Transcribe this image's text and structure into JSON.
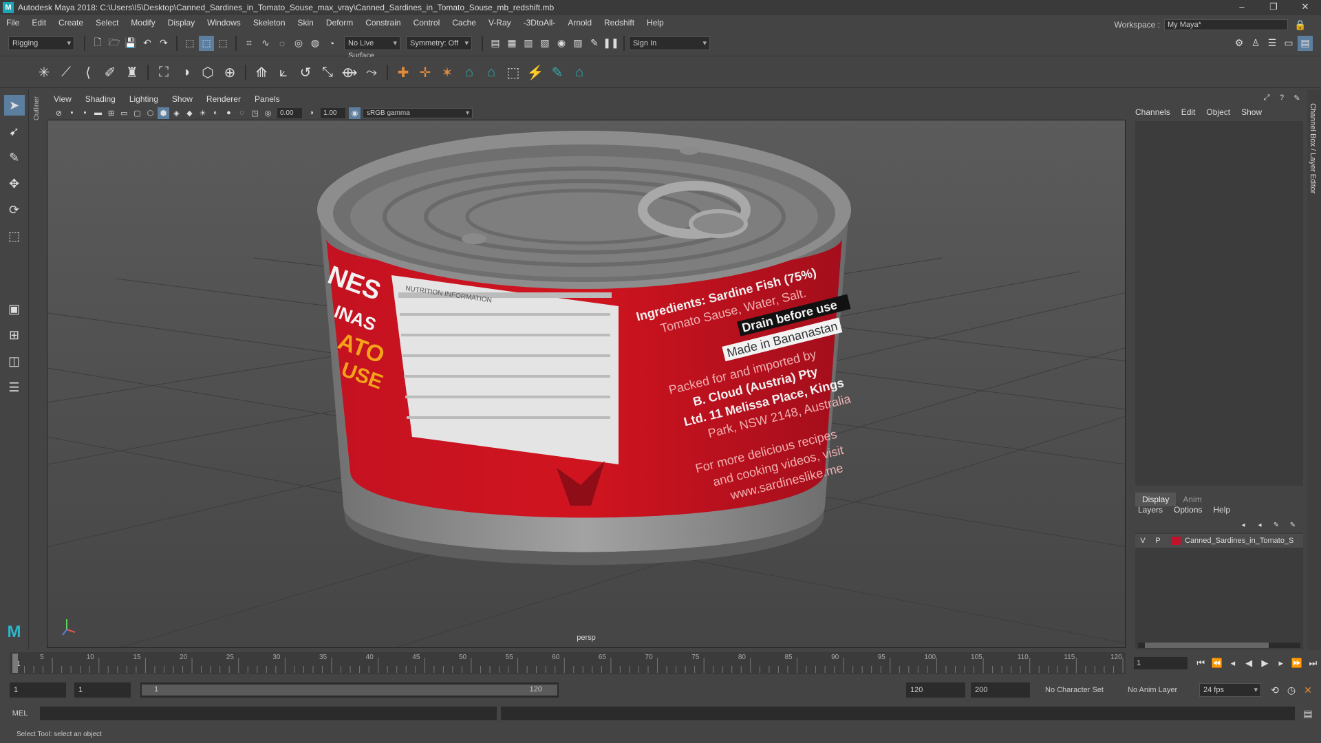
{
  "window": {
    "title": "Autodesk Maya 2018: C:\\Users\\I5\\Desktop\\Canned_Sardines_in_Tomato_Souse_max_vray\\Canned_Sardines_in_Tomato_Souse_mb_redshift.mb",
    "app_icon": "maya-logo-icon",
    "minimize": "–",
    "restore": "❐",
    "close": "✕"
  },
  "menubar": {
    "items": [
      "File",
      "Edit",
      "Create",
      "Select",
      "Modify",
      "Display",
      "Windows",
      "Skeleton",
      "Skin",
      "Deform",
      "Constrain",
      "Control",
      "Cache",
      "V-Ray",
      "-3DtoAll-",
      "Arnold",
      "Redshift",
      "Help"
    ],
    "workspace_label": "Workspace :",
    "workspace_value": "My Maya*"
  },
  "statusline": {
    "menuset": "Rigging",
    "live_surface": "No Live Surface",
    "symmetry": "Symmetry: Off",
    "sign_in": "Sign In"
  },
  "viewport": {
    "menu": [
      "View",
      "Shading",
      "Lighting",
      "Show",
      "Renderer",
      "Panels"
    ],
    "exposure": "0.00",
    "gamma": "1.00",
    "color_space": "sRGB gamma",
    "camera_label": "persp",
    "model": {
      "label_brand": "NES",
      "label_sub": "INAS",
      "label_sub2": "ATO",
      "label_sub3": "USE",
      "nutrition_title": "NUTRITION INFORMATION",
      "ingredients": "Ingredients: Sardine Fish (75%)",
      "ingredients2": "Tomato Sause, Water, Salt.",
      "drain": "Drain before use",
      "made_in": "Made in Bananastan",
      "packed1": "Packed for and imported by",
      "packed2": "B. Cloud (Austria) Pty",
      "packed3": "Ltd. 11 Melissa Place, Kings",
      "packed4": "Park, NSW 2148, Australia",
      "more1": "For more delicious recipes",
      "more2": "and cooking videos, visit",
      "more3": "www.sardineslike.me"
    }
  },
  "channelbox": {
    "tabs": [
      "Channels",
      "Edit",
      "Object",
      "Show"
    ],
    "side_label": "Channel Box / Layer Editor"
  },
  "layereditor": {
    "tabs": [
      "Display",
      "Anim"
    ],
    "menu": [
      "Layers",
      "Options",
      "Help"
    ],
    "layer": {
      "v": "V",
      "p": "P",
      "name": "Canned_Sardines_in_Tomato_S",
      "color": "#c0122a"
    }
  },
  "timeline": {
    "ticks": [
      "5",
      "10",
      "15",
      "20",
      "25",
      "30",
      "35",
      "40",
      "45",
      "50",
      "55",
      "60",
      "65",
      "70",
      "75",
      "80",
      "85",
      "90",
      "95",
      "100",
      "105",
      "110",
      "115",
      "120"
    ],
    "start_tick": "1",
    "current_frame": "1",
    "range_start": "1",
    "anim_start": "1",
    "slider_start": "1",
    "slider_end": "120",
    "range_end": "120",
    "anim_end": "200",
    "character_set": "No Character Set",
    "anim_layer": "No Anim Layer",
    "fps": "24 fps"
  },
  "command": {
    "lang": "MEL",
    "help": "Select Tool: select an object"
  },
  "outliner_tab": "Outliner"
}
